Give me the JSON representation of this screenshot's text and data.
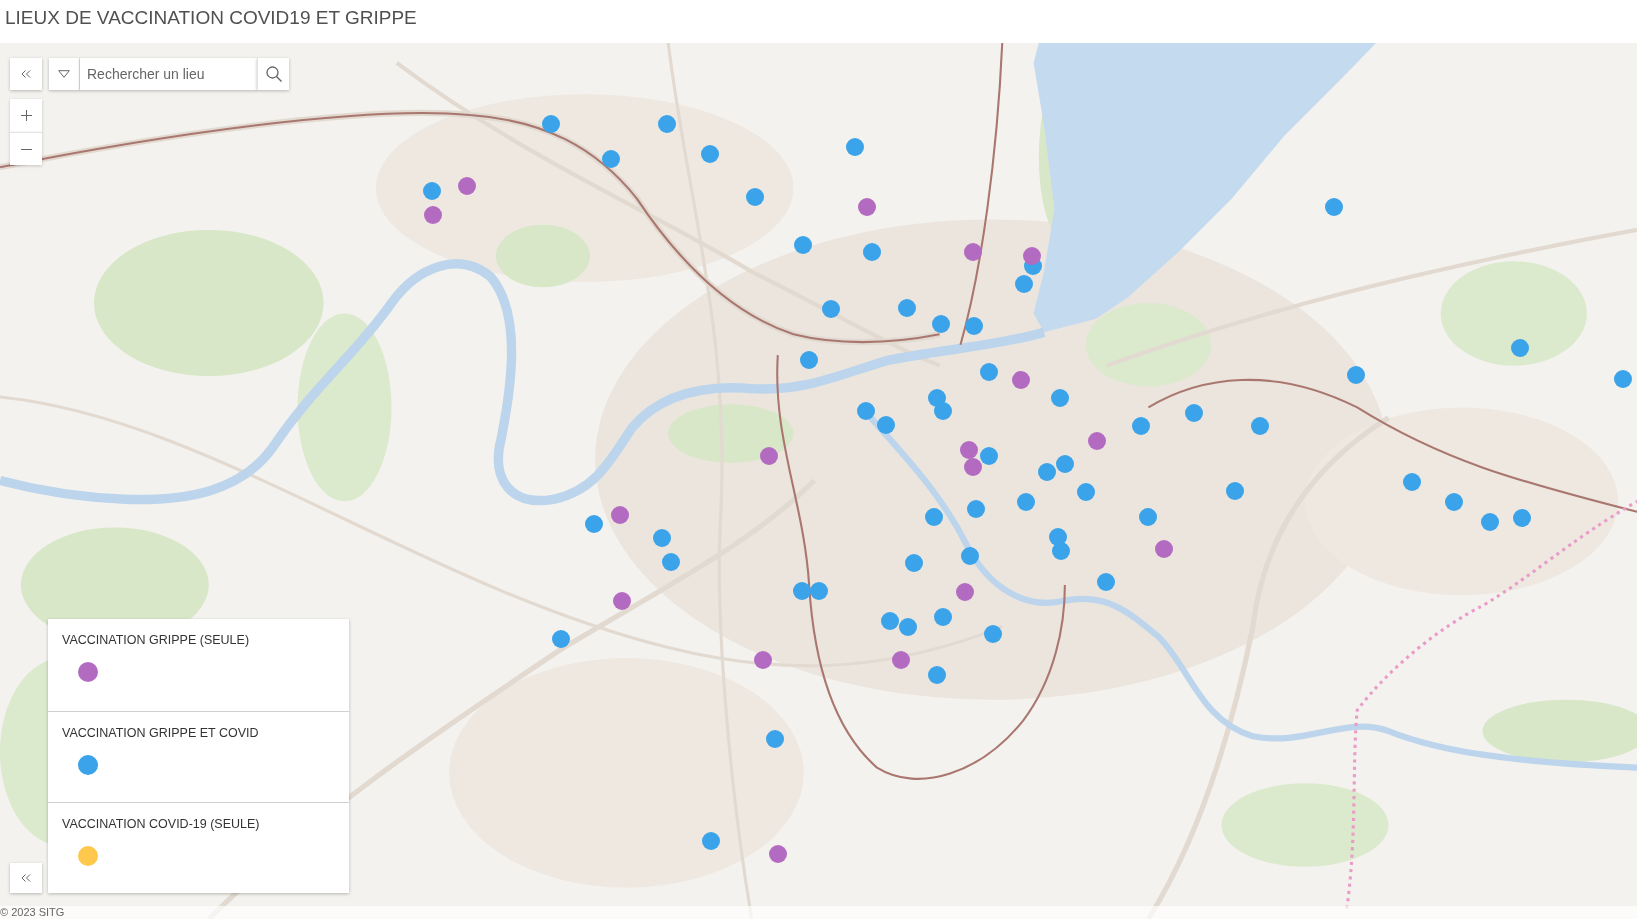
{
  "header": {
    "title": "LIEUX DE VACCINATION COVID19 ET GRIPPE"
  },
  "search": {
    "placeholder": "Rechercher un lieu"
  },
  "legend": {
    "items": [
      {
        "label": "VACCINATION GRIPPE (SEULE)",
        "color": "#b36bc1"
      },
      {
        "label": "VACCINATION GRIPPE ET COVID",
        "color": "#3aa3e9"
      },
      {
        "label": "VACCINATION COVID-19 (SEULE)",
        "color": "#fdc84b"
      }
    ]
  },
  "markers": [
    {
      "color": "#3aa3e9"
    },
    {
      "color": "#3aa3e9"
    },
    {
      "color": "#3aa3e9"
    },
    {
      "color": "#3aa3e9"
    },
    {
      "color": "#3aa3e9"
    },
    {
      "color": "#3aa3e9"
    },
    {
      "color": "#b36bc1"
    },
    {
      "color": "#b36bc1"
    },
    {
      "color": "#3aa3e9"
    },
    {
      "color": "#b36bc1"
    },
    {
      "color": "#3aa3e9"
    },
    {
      "color": "#3aa3e9"
    },
    {
      "color": "#b36bc1"
    },
    {
      "color": "#3aa3e9"
    },
    {
      "color": "#b36bc1"
    },
    {
      "color": "#3aa3e9"
    },
    {
      "color": "#3aa3e9"
    },
    {
      "color": "#3aa3e9"
    },
    {
      "color": "#3aa3e9"
    },
    {
      "color": "#3aa3e9"
    },
    {
      "color": "#3aa3e9"
    },
    {
      "color": "#3aa3e9"
    },
    {
      "color": "#3aa3e9"
    },
    {
      "color": "#b36bc1"
    },
    {
      "color": "#3aa3e9"
    },
    {
      "color": "#3aa3e9"
    },
    {
      "color": "#3aa3e9"
    },
    {
      "color": "#3aa3e9"
    },
    {
      "color": "#3aa3e9"
    },
    {
      "color": "#3aa3e9"
    },
    {
      "color": "#3aa3e9"
    },
    {
      "color": "#3aa3e9"
    },
    {
      "color": "#3aa3e9"
    },
    {
      "color": "#3aa3e9"
    },
    {
      "color": "#3aa3e9"
    },
    {
      "color": "#b36bc1"
    },
    {
      "color": "#b36bc1"
    },
    {
      "color": "#b36bc1"
    },
    {
      "color": "#b36bc1"
    },
    {
      "color": "#3aa3e9"
    },
    {
      "color": "#3aa3e9"
    },
    {
      "color": "#3aa3e9"
    },
    {
      "color": "#3aa3e9"
    },
    {
      "color": "#3aa3e9"
    },
    {
      "color": "#3aa3e9"
    },
    {
      "color": "#3aa3e9"
    },
    {
      "color": "#3aa3e9"
    },
    {
      "color": "#3aa3e9"
    },
    {
      "color": "#3aa3e9"
    },
    {
      "color": "#3aa3e9"
    },
    {
      "color": "#3aa3e9"
    },
    {
      "color": "#3aa3e9"
    },
    {
      "color": "#b36bc1"
    },
    {
      "color": "#3aa3e9"
    },
    {
      "color": "#3aa3e9"
    },
    {
      "color": "#3aa3e9"
    },
    {
      "color": "#3aa3e9"
    },
    {
      "color": "#3aa3e9"
    },
    {
      "color": "#b36bc1"
    },
    {
      "color": "#3aa3e9"
    },
    {
      "color": "#3aa3e9"
    },
    {
      "color": "#3aa3e9"
    },
    {
      "color": "#3aa3e9"
    },
    {
      "color": "#3aa3e9"
    },
    {
      "color": "#b36bc1"
    },
    {
      "color": "#b36bc1"
    },
    {
      "color": "#3aa3e9"
    },
    {
      "color": "#3aa3e9"
    },
    {
      "color": "#3aa3e9"
    },
    {
      "color": "#3aa3e9"
    },
    {
      "color": "#3aa3e9"
    },
    {
      "color": "#b36bc1"
    },
    {
      "color": "#b36bc1"
    },
    {
      "color": "#3aa3e9"
    },
    {
      "color": "#3aa3e9"
    },
    {
      "color": "#3aa3e9"
    },
    {
      "color": "#b36bc1"
    }
  ],
  "attribution": "© 2023 SITG"
}
